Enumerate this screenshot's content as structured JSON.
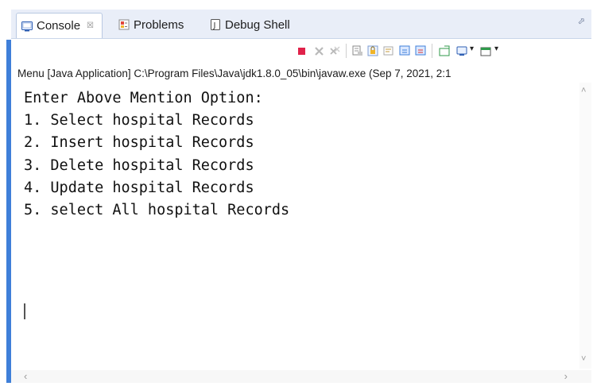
{
  "tabs": [
    {
      "label": "Console",
      "close": "☒",
      "icon": "console-icon",
      "active": true
    },
    {
      "label": "Problems",
      "icon": "problems-icon",
      "active": false
    },
    {
      "label": "Debug Shell",
      "icon": "debug-shell-icon",
      "active": false
    }
  ],
  "view_menu_glyph": "⬀",
  "toolbar": {
    "icons": [
      "terminate-icon",
      "remove-launch-icon",
      "remove-all-terminated-icon",
      "clear-console-icon",
      "scroll-lock-icon",
      "word-wrap-icon",
      "show-on-stdout-icon",
      "show-on-stderr-icon",
      "pin-console-icon",
      "display-console-icon",
      "open-console-icon"
    ],
    "caret": "▾",
    "colors": {
      "terminate": "#e0224a",
      "accent_blue": "#3f7fd9",
      "green": "#2f9a4a"
    }
  },
  "launch_label": "Menu [Java Application] C:\\Program Files\\Java\\jdk1.8.0_05\\bin\\javaw.exe (Sep 7, 2021, 2:1",
  "console_lines": [
    "Enter Above Mention Option:",
    "1. Select hospital Records",
    "2. Insert hospital Records",
    "3. Delete hospital Records",
    "4. Update hospital Records",
    "5. select All hospital Records"
  ],
  "scroll": {
    "up": "˄",
    "down": "˅",
    "left": "‹",
    "right": "›"
  }
}
